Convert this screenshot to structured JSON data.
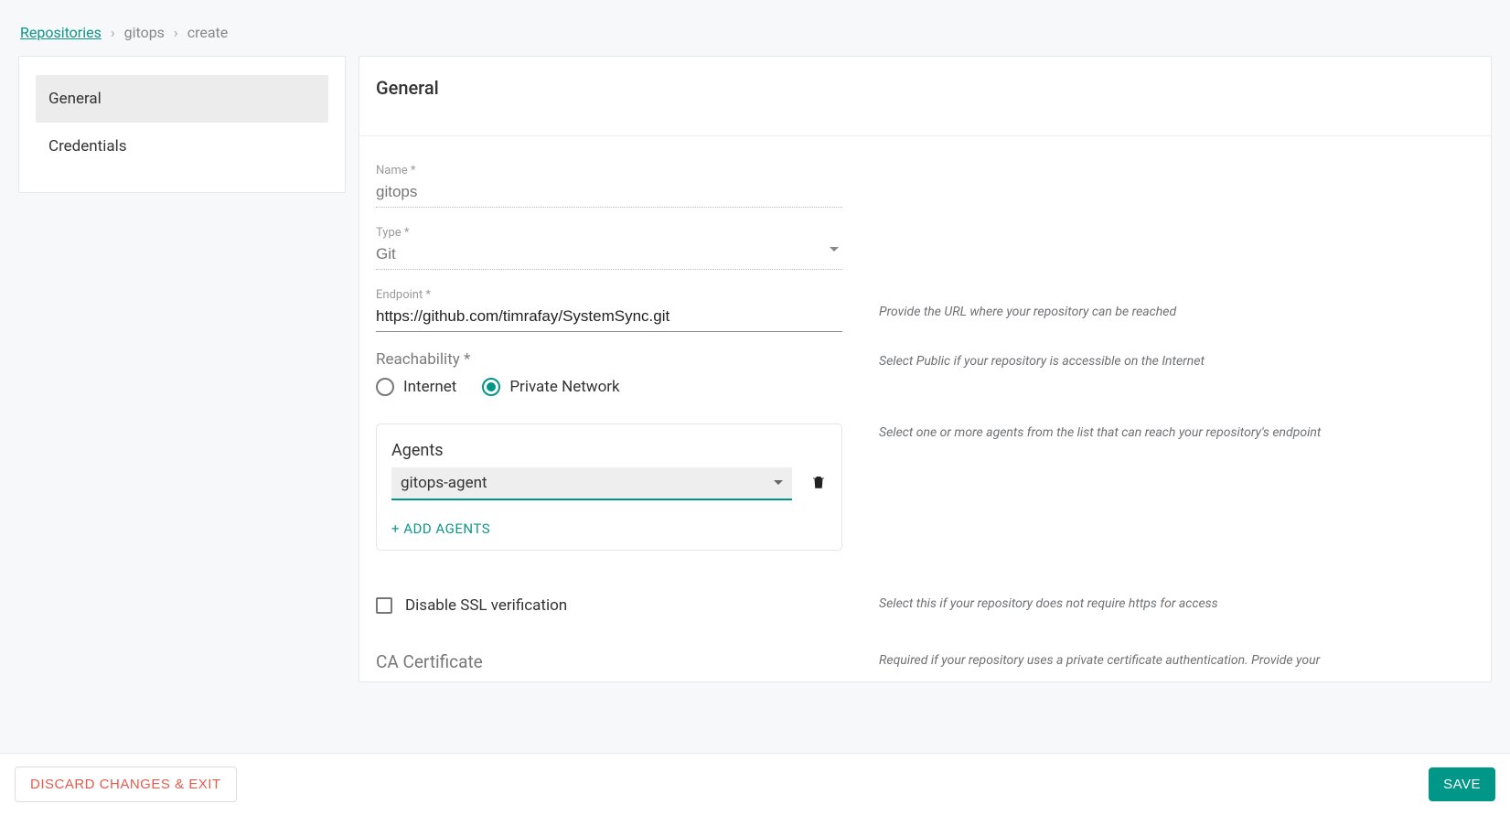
{
  "breadcrumb": {
    "root": "Repositories",
    "mid": "gitops",
    "leaf": "create"
  },
  "sidebar": {
    "items": [
      {
        "label": "General",
        "active": true
      },
      {
        "label": "Credentials",
        "active": false
      }
    ]
  },
  "main": {
    "title": "General",
    "name": {
      "label": "Name *",
      "value": "gitops"
    },
    "type": {
      "label": "Type *",
      "value": "Git"
    },
    "endpoint": {
      "label": "Endpoint *",
      "value": "https://github.com/timrafay/SystemSync.git",
      "help": "Provide the URL where your repository can be reached"
    },
    "reachability": {
      "label": "Reachability *",
      "options": {
        "internet": "Internet",
        "private": "Private Network"
      },
      "selected": "private",
      "help": "Select Public if your repository is accessible on the Internet"
    },
    "agents": {
      "title": "Agents",
      "selected": "gitops-agent",
      "add_label": "+ ADD  AGENTS",
      "help": "Select one or more agents from the list that can reach your repository's endpoint"
    },
    "ssl": {
      "label": "Disable SSL verification",
      "checked": false,
      "help": "Select this if your repository does not require https for access"
    },
    "ca": {
      "title": "CA Certificate",
      "help": "Required if your repository uses a private certificate authentication. Provide your"
    }
  },
  "footer": {
    "discard": "DISCARD CHANGES & EXIT",
    "save": "SAVE"
  }
}
